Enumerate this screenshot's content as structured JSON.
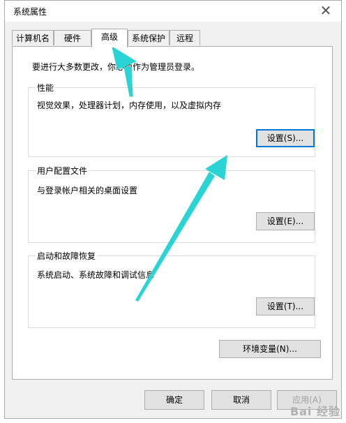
{
  "window": {
    "title": "系统属性",
    "close_glyph": "✕"
  },
  "tabs": [
    {
      "label": "计算机名"
    },
    {
      "label": "硬件"
    },
    {
      "label": "高级"
    },
    {
      "label": "系统保护"
    },
    {
      "label": "远程"
    }
  ],
  "admin_note": "要进行大多数更改，你必须作为管理员登录。",
  "groups": {
    "performance": {
      "title": "性能",
      "desc": "视觉效果，处理器计划，内存使用，以及虚拟内存",
      "button": "设置(S)..."
    },
    "profile": {
      "title": "用户配置文件",
      "desc": "与登录帐户相关的桌面设置",
      "button": "设置(E)..."
    },
    "startup": {
      "title": "启动和故障恢复",
      "desc": "系统启动、系统故障和调试信息",
      "button": "设置(T)..."
    }
  },
  "env_button": "环境变量(N)...",
  "footer": {
    "ok": "确定",
    "cancel": "取消",
    "apply": "应用(A)"
  },
  "watermark": "Bai 经验",
  "colors": {
    "arrow": "#2ad4d4",
    "accent": "#0078d7"
  }
}
